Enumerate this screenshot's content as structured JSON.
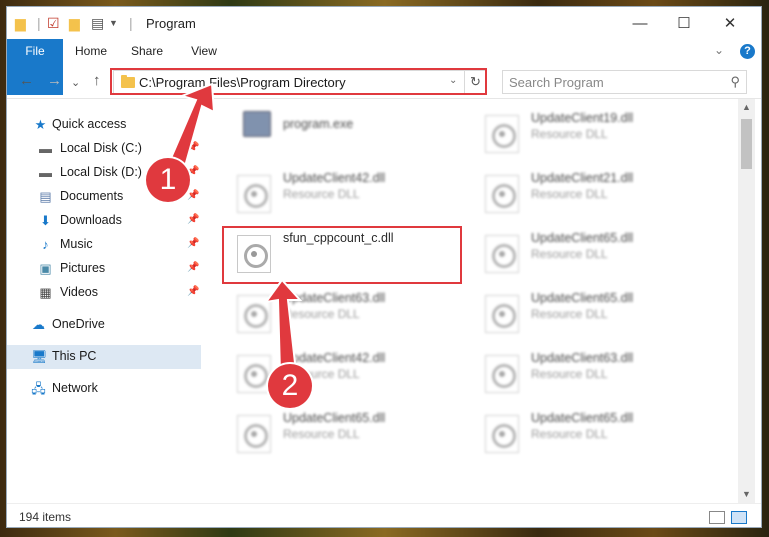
{
  "titlebar": {
    "title": "Program",
    "minimize": "—",
    "maximize": "☐",
    "close": "✕"
  },
  "ribbon": {
    "tabs": [
      "File",
      "Home",
      "Share",
      "View"
    ],
    "collapse": "⌄",
    "help": "?"
  },
  "navbar": {
    "back": "←",
    "forward": "→",
    "recent": "⌄",
    "up": "↑",
    "address": "C:\\Program Files\\Program Directory",
    "dropdown": "⌄",
    "refresh": "↻",
    "search_placeholder": "Search Program",
    "search_icon": "⚲"
  },
  "nav_pane": {
    "items": [
      {
        "label": "Quick access",
        "icon": "quick-access-star-icon",
        "pinned": false
      },
      {
        "label": "Local Disk (C:)",
        "icon": "drive-icon",
        "pinned": true
      },
      {
        "label": "Local Disk (D:)",
        "icon": "drive-icon",
        "pinned": true
      },
      {
        "label": "Documents",
        "icon": "documents-icon",
        "pinned": true
      },
      {
        "label": "Downloads",
        "icon": "downloads-icon",
        "pinned": true
      },
      {
        "label": "Music",
        "icon": "music-icon",
        "pinned": true
      },
      {
        "label": "Pictures",
        "icon": "pictures-icon",
        "pinned": true
      },
      {
        "label": "Videos",
        "icon": "videos-icon",
        "pinned": true
      },
      {
        "label": "OneDrive",
        "icon": "onedrive-icon",
        "pinned": false
      },
      {
        "label": "This PC",
        "icon": "this-pc-icon",
        "pinned": false,
        "selected": true
      },
      {
        "label": "Network",
        "icon": "network-icon",
        "pinned": false
      }
    ]
  },
  "files": [
    {
      "name": "program.exe",
      "type": "",
      "blurred": true,
      "icon": "exe-icon"
    },
    {
      "name": "UpdateClient19.dll",
      "type": "Resource DLL",
      "blurred": true,
      "icon": "dll-icon"
    },
    {
      "name": "UpdateClient42.dll",
      "type": "Resource DLL",
      "blurred": true,
      "icon": "dll-icon"
    },
    {
      "name": "UpdateClient21.dll",
      "type": "Resource DLL",
      "blurred": true,
      "icon": "dll-icon"
    },
    {
      "name": "sfun_cppcount_c.dll",
      "type": "",
      "blurred": false,
      "icon": "dll-icon"
    },
    {
      "name": "UpdateClient65.dll",
      "type": "Resource DLL",
      "blurred": true,
      "icon": "dll-icon"
    },
    {
      "name": "UpdateClient63.dll",
      "type": "Resource DLL",
      "blurred": true,
      "icon": "dll-icon"
    },
    {
      "name": "UpdateClient65.dll",
      "type": "Resource DLL",
      "blurred": true,
      "icon": "dll-icon"
    },
    {
      "name": "UpdateClient42.dll",
      "type": "Resource DLL",
      "blurred": true,
      "icon": "dll-icon"
    },
    {
      "name": "UpdateClient63.dll",
      "type": "Resource DLL",
      "blurred": true,
      "icon": "dll-icon"
    },
    {
      "name": "UpdateClient65.dll",
      "type": "Resource DLL",
      "blurred": true,
      "icon": "dll-icon"
    },
    {
      "name": "UpdateClient65.dll",
      "type": "Resource DLL",
      "blurred": true,
      "icon": "dll-icon"
    }
  ],
  "status": {
    "item_count": "194 items"
  },
  "annotations": {
    "step1": "1",
    "step2": "2",
    "color": "#e0393e"
  },
  "colors": {
    "accent": "#1979ca",
    "selection": "#dde8f3"
  }
}
